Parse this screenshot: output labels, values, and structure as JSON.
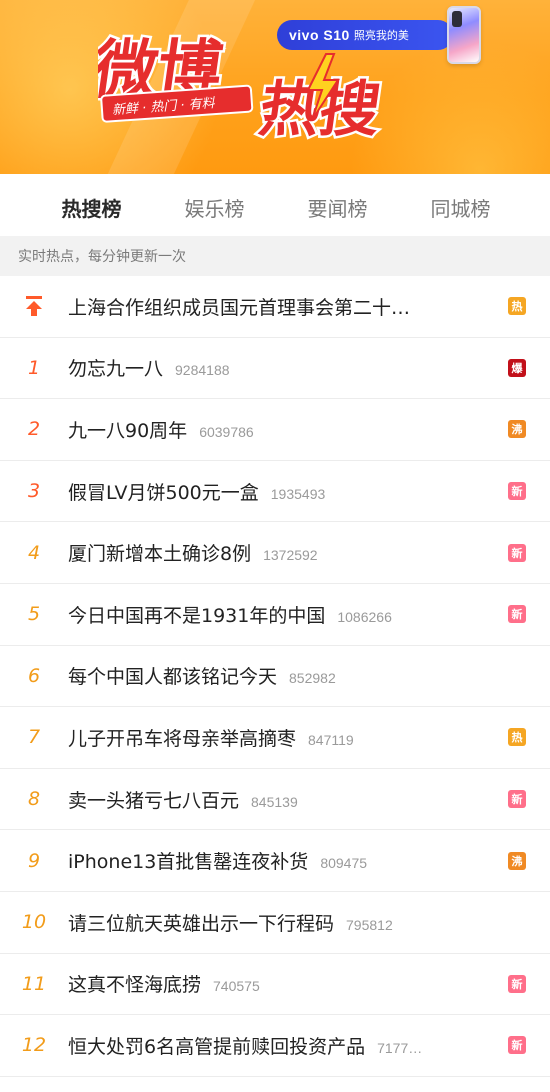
{
  "banner": {
    "logo_line1": "微博",
    "logo_line2": "热搜",
    "slogan": "新鲜 · 热门 · 有料",
    "ad_brand": "vivo S10",
    "ad_slogan": "照亮我的美",
    "colors": {
      "background": "#ffa21c",
      "logo_red": "#e62d2d",
      "ad_blue": "#3b4ee8"
    }
  },
  "tabs": [
    {
      "label": "热搜榜",
      "active": true
    },
    {
      "label": "娱乐榜",
      "active": false
    },
    {
      "label": "要闻榜",
      "active": false
    },
    {
      "label": "同城榜",
      "active": false
    }
  ],
  "subheader": "实时热点，每分钟更新一次",
  "badges": {
    "热": "#f5a623",
    "爆": "#c2101a",
    "沸": "#f08a24",
    "新": "#ff6f8a"
  },
  "items": [
    {
      "rank": "",
      "pinned": true,
      "title": "上海合作组织成员国元首理事会第二十…",
      "count": "",
      "badge": "热"
    },
    {
      "rank": "1",
      "title": "勿忘九一八",
      "count": "9284188",
      "badge": "爆"
    },
    {
      "rank": "2",
      "title": "九一八90周年",
      "count": "6039786",
      "badge": "沸"
    },
    {
      "rank": "3",
      "title": "假冒LV月饼500元一盒",
      "count": "1935493",
      "badge": "新"
    },
    {
      "rank": "4",
      "title": "厦门新增本土确诊8例",
      "count": "1372592",
      "badge": "新"
    },
    {
      "rank": "5",
      "title": "今日中国再不是1931年的中国",
      "count": "1086266",
      "badge": "新"
    },
    {
      "rank": "6",
      "title": "每个中国人都该铭记今天",
      "count": "852982",
      "badge": ""
    },
    {
      "rank": "7",
      "title": "儿子开吊车将母亲举高摘枣",
      "count": "847119",
      "badge": "热"
    },
    {
      "rank": "8",
      "title": "卖一头猪亏七八百元",
      "count": "845139",
      "badge": "新"
    },
    {
      "rank": "9",
      "title": "iPhone13首批售罄连夜补货",
      "count": "809475",
      "badge": "沸"
    },
    {
      "rank": "10",
      "title": "请三位航天英雄出示一下行程码",
      "count": "795812",
      "badge": ""
    },
    {
      "rank": "11",
      "title": "这真不怪海底捞",
      "count": "740575",
      "badge": "新"
    },
    {
      "rank": "12",
      "title": "恒大处罚6名高管提前赎回投资产品",
      "count": "7177…",
      "badge": "新"
    }
  ]
}
